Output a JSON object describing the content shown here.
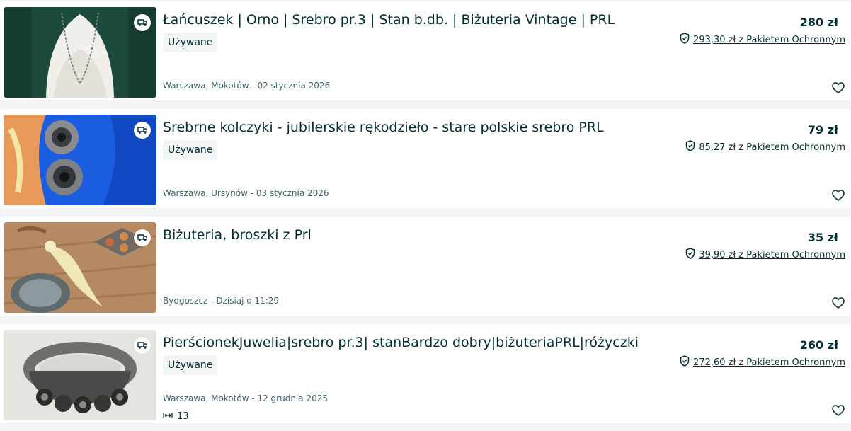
{
  "listings": [
    {
      "title": "Łańcuszek | Orno | Srebro pr.3 | Stan b.db. | Biżuteria Vintage | PRL",
      "condition": "Używane",
      "location": "Warszawa, Mokotów - 02 stycznia 2026",
      "price": "280 zł",
      "protection": "293,30 zł z Pakietem Ochronnym",
      "image_icon": "necklace-photo"
    },
    {
      "title": "Srebrne kolczyki - jubilerskie rękodzieło - stare polskie srebro PRL",
      "condition": "Używane",
      "location": "Warszawa, Ursynów - 03 stycznia 2026",
      "price": "79 zł",
      "protection": "85,27 zł z Pakietem Ochronnym",
      "image_icon": "earrings-photo"
    },
    {
      "title": "Biżuteria, broszki z Prl",
      "location": "Bydgoszcz - Dzisiaj o 11:29",
      "price": "35 zł",
      "protection": "39,90 zł z Pakietem Ochronnym",
      "image_icon": "brooches-photo"
    },
    {
      "title": "PierścionekJuwelia|srebro pr.3| stanBardzo dobry|biżuteriaPRL|różyczki",
      "condition": "Używane",
      "location": "Warszawa, Mokotów - 12 grudnia 2025",
      "price": "260 zł",
      "protection": "272,60 zł z Pakietem Ochronnym",
      "extra_value": "13",
      "image_icon": "ring-photo"
    }
  ],
  "icons": {
    "delivery": "delivery-truck-icon",
    "protection": "shield-check-icon",
    "favorite": "heart-icon",
    "size": "ring-size-icon"
  },
  "colors": {
    "text": "#002f34",
    "muted": "#406367",
    "badge_bg": "#f2f4f5"
  }
}
